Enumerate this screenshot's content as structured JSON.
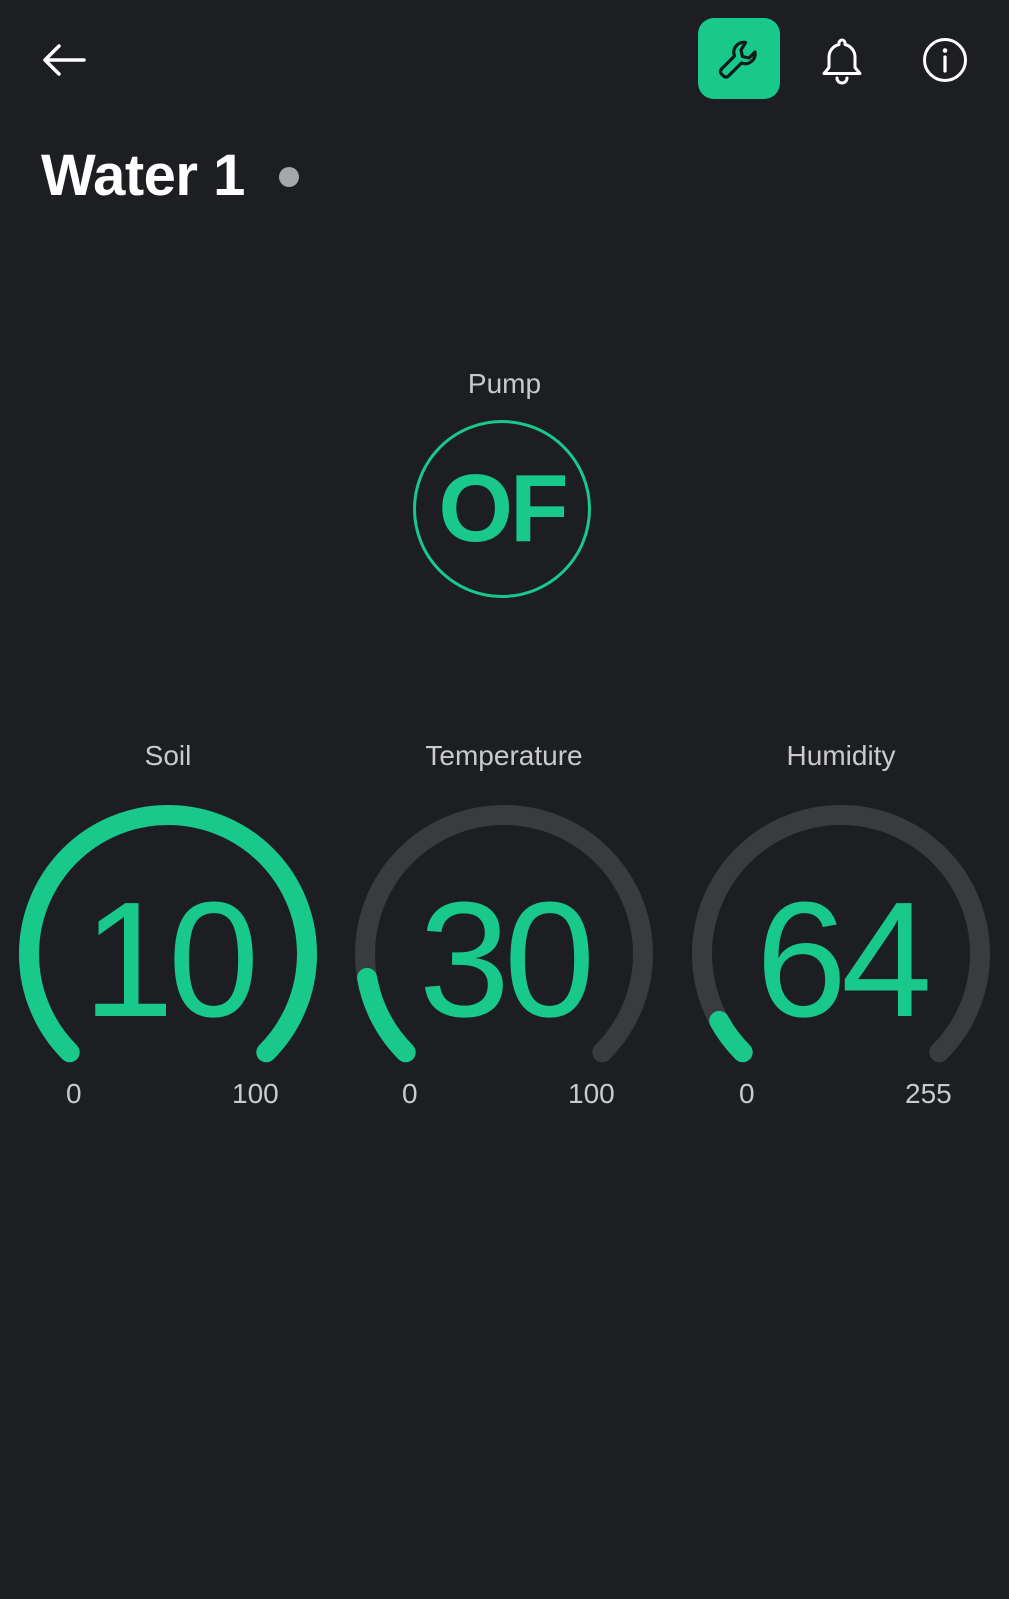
{
  "header": {
    "back_icon": "arrow-left-icon",
    "settings_icon": "wrench-icon",
    "notifications_icon": "bell-icon",
    "info_icon": "info-icon",
    "accent_color": "#18c98b"
  },
  "device": {
    "title": "Water 1",
    "status": "offline",
    "status_color": "#a6a7ab"
  },
  "pump": {
    "label": "Pump",
    "state": "OF"
  },
  "gauges": [
    {
      "label": "Soil",
      "value": "10",
      "min": "0",
      "max": "100",
      "level": 1.0
    },
    {
      "label": "Temperature",
      "value": "30",
      "min": "0",
      "max": "100",
      "level": 0.13
    },
    {
      "label": "Humidity",
      "value": "64",
      "min": "0",
      "max": "255",
      "level": 0.06
    }
  ],
  "colors": {
    "background": "#1d1e22",
    "gauge_track": "#3a3b3f",
    "gauge_fill": "#18c98b",
    "label": "#c9cacd"
  }
}
